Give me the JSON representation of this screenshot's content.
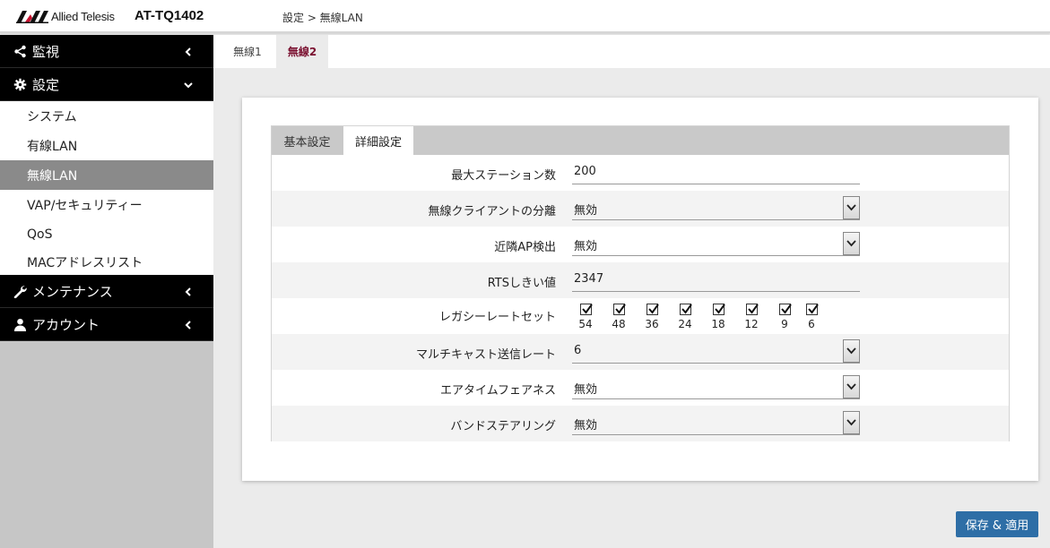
{
  "header": {
    "brand": "Allied Telesis",
    "model": "AT-TQ1402",
    "breadcrumb": "設定 > 無線LAN"
  },
  "sidebar": {
    "monitor": "監視",
    "settings": "設定",
    "sub_items": [
      "システム",
      "有線LAN",
      "無線LAN",
      "VAP/セキュリティー",
      "QoS",
      "MACアドレスリスト"
    ],
    "maintenance": "メンテナンス",
    "account": "アカウント"
  },
  "radio_tabs": [
    "無線1",
    "無線2"
  ],
  "form_tabs": [
    "基本設定",
    "詳細設定"
  ],
  "fields": {
    "max_stations": {
      "label": "最大ステーション数",
      "value": "200"
    },
    "client_isolation": {
      "label": "無線クライアントの分離",
      "value": "無効"
    },
    "neighbor_ap": {
      "label": "近隣AP検出",
      "value": "無効"
    },
    "rts_threshold": {
      "label": "RTSしきい値",
      "value": "2347"
    },
    "legacy_rates": {
      "label": "レガシーレートセット",
      "rates": [
        "54",
        "48",
        "36",
        "24",
        "18",
        "12",
        "9",
        "6"
      ],
      "checked": [
        true,
        true,
        true,
        true,
        true,
        true,
        true,
        true
      ]
    },
    "multicast_rate": {
      "label": "マルチキャスト送信レート",
      "value": "6"
    },
    "airtime_fairness": {
      "label": "エアタイムフェアネス",
      "value": "無効"
    },
    "band_steering": {
      "label": "バンドステアリング",
      "value": "無効"
    }
  },
  "save_button": "保存 & 適用",
  "colors": {
    "accent_tab": "#7a1030",
    "button": "#2e6ea6",
    "sidebar_active": "#8a8a8a"
  }
}
